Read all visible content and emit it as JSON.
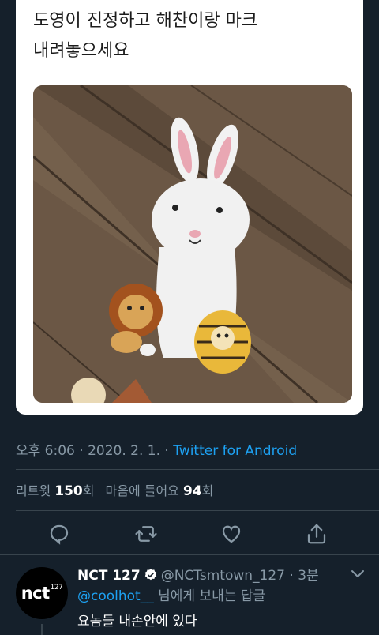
{
  "quoted_tweet": {
    "line1": "도영이 진정하고 해찬이랑 마크",
    "line2": "내려놓으세요",
    "image": "photo: embroidered white rabbit patch holding a lion patch and a tiger patch on a wooden surface"
  },
  "meta": {
    "time": "오후 6:06",
    "sep": " · ",
    "date": "2020. 2. 1.",
    "source": "Twitter for Android"
  },
  "stats": {
    "retweets_label": "리트윗",
    "retweets_count": "150",
    "retweets_unit": "회",
    "likes_label": "마음에 들어요",
    "likes_count": "94",
    "likes_unit": "회"
  },
  "actions": {
    "icons": [
      "reply-icon",
      "retweet-icon",
      "like-icon",
      "share-icon"
    ]
  },
  "reply": {
    "avatar_text": "nct",
    "avatar_sup": "127",
    "name": "NCT 127",
    "handle_time": "@NCTsmtown_127 · 3분",
    "mention": "@coolhot__",
    "to_suffix": " 님에게 보내는 답글",
    "body": "요놈들 내손안에 있다"
  },
  "colors": {
    "background": "#15202b",
    "accent": "#1da1f2",
    "secondary_text": "#8899a6",
    "divider": "#38444d"
  }
}
